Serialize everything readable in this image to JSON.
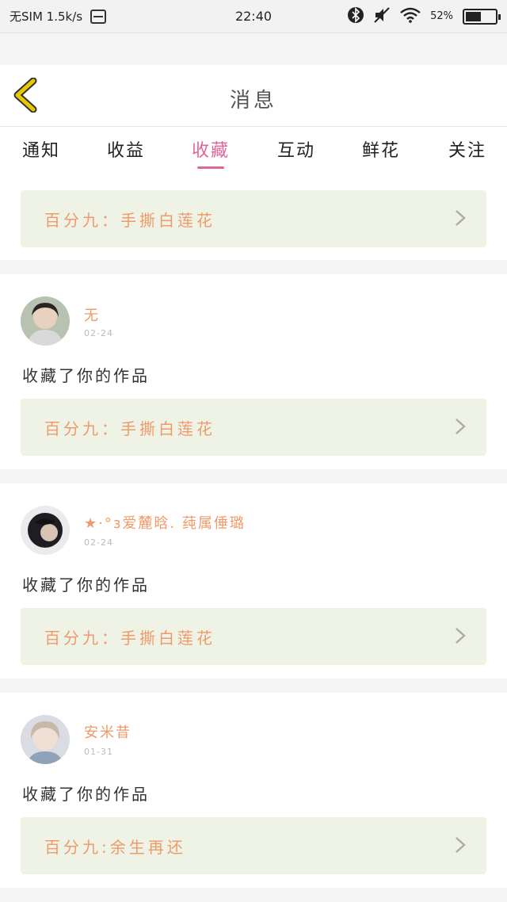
{
  "status_bar": {
    "carrier": "无SIM 1.5k/s",
    "time": "22:40",
    "battery": "52%",
    "battery_level": 0.52
  },
  "header": {
    "title": "消息"
  },
  "tabs": [
    {
      "label": "通知"
    },
    {
      "label": "收益"
    },
    {
      "label": "收藏",
      "active": true
    },
    {
      "label": "互动"
    },
    {
      "label": "鲜花"
    },
    {
      "label": "关注"
    }
  ],
  "items": [
    {
      "work_title": "百分九：手撕白莲花"
    },
    {
      "user": "无",
      "date": "02-24",
      "action": "收藏了你的作品",
      "work_title": "百分九：手撕白莲花"
    },
    {
      "user": "★·°з爱麓晗. 莼属倕璐",
      "date": "02-24",
      "action": "收藏了你的作品",
      "work_title": "百分九：手撕白莲花"
    },
    {
      "user": "安米昔",
      "date": "01-31",
      "action": "收藏了你的作品",
      "work_title": "百分九:余生再还"
    }
  ],
  "colors": {
    "accent": "#e0669a",
    "work_text": "#ef9a6a",
    "work_bg": "#eff3e6"
  },
  "icons": [
    "database-icon",
    "bluetooth-icon",
    "mute-icon",
    "wifi-icon",
    "battery-icon",
    "back-chevron-icon",
    "chevron-right-icon"
  ]
}
